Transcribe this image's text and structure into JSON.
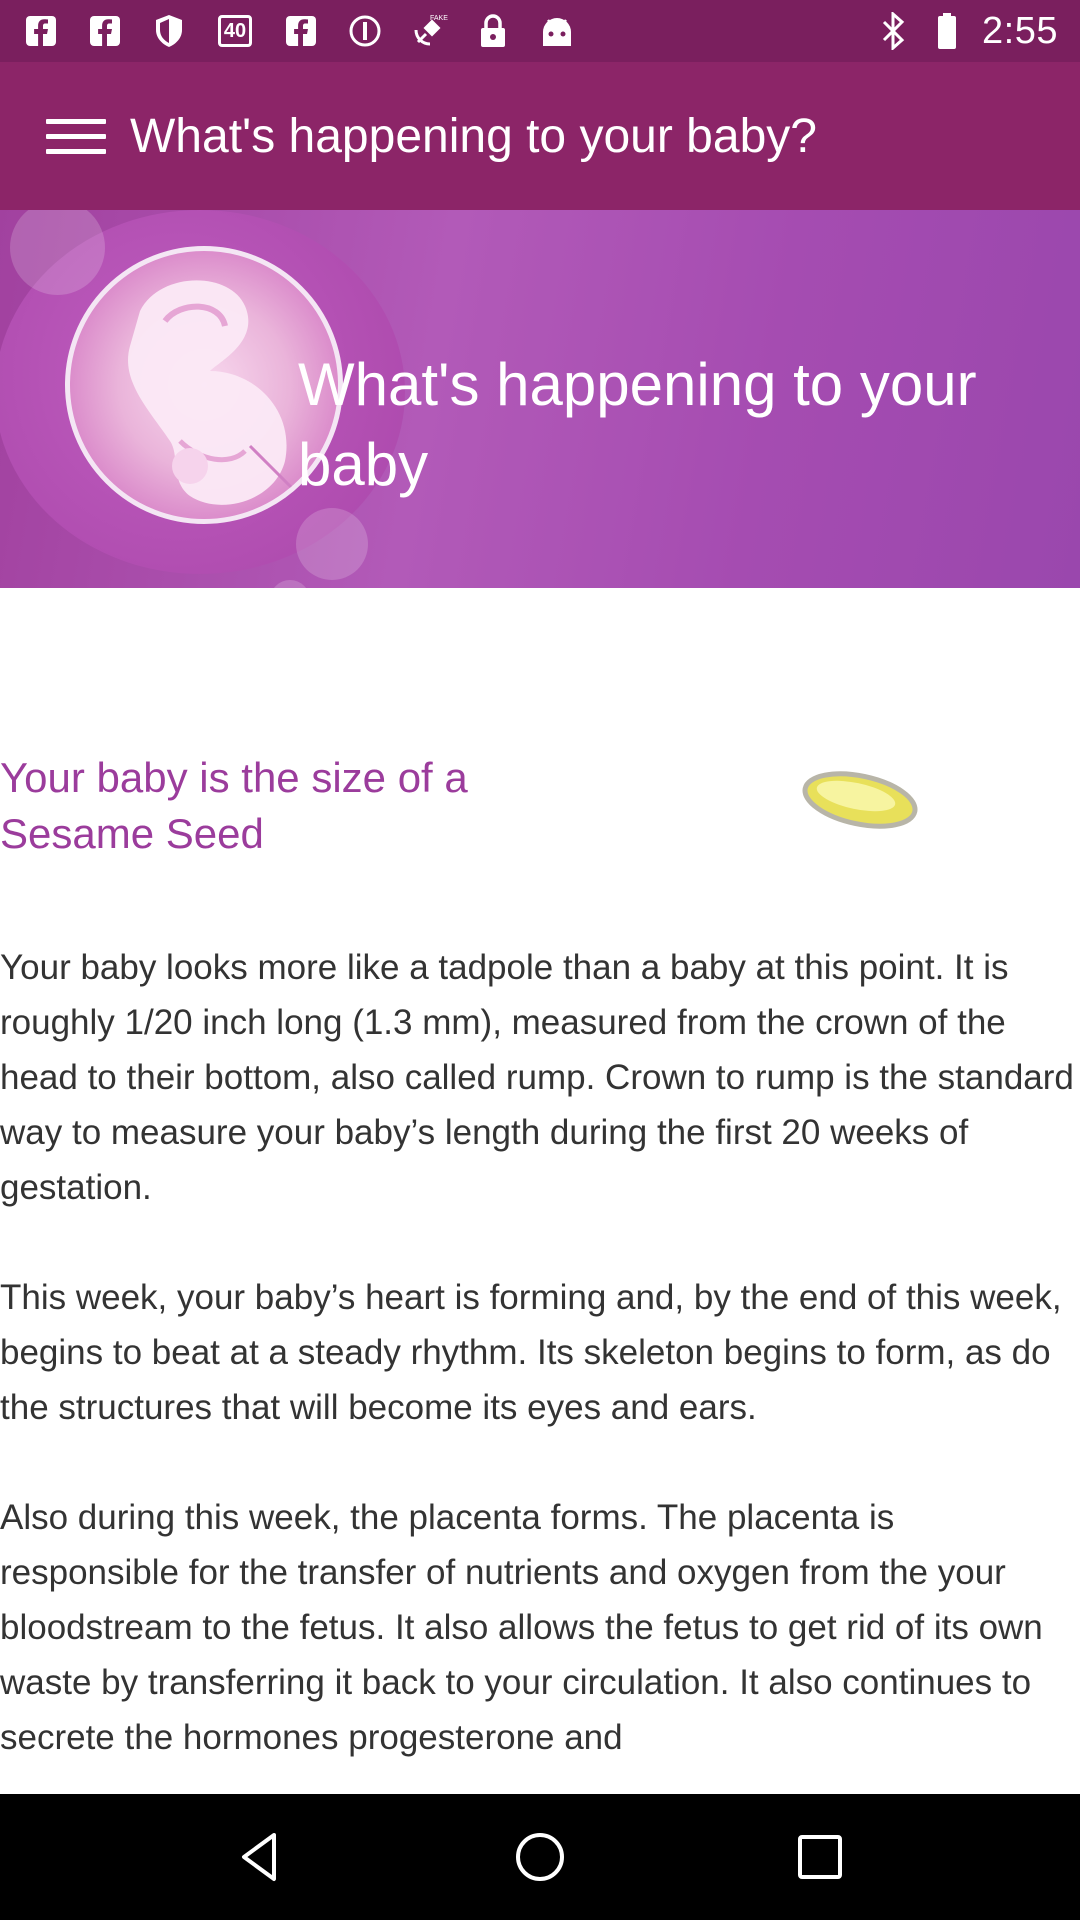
{
  "status_bar": {
    "time": "2:55",
    "left_icons": [
      "facebook-icon",
      "facebook-icon",
      "shield-icon",
      "forty-badge-icon",
      "facebook-icon",
      "info-circle-icon",
      "fake-gps-icon",
      "lock-icon",
      "android-icon"
    ],
    "badge_text": "40",
    "right_icons": [
      "bluetooth-icon"
    ]
  },
  "app_bar": {
    "title": "What's happening to your baby?"
  },
  "hero": {
    "title": "What's happening to your baby"
  },
  "size": {
    "text": "Your baby is the size of a Sesame Seed",
    "accent_color": "#9b3c9c",
    "image": "sesame-seed-icon"
  },
  "article": {
    "paragraphs": [
      "Your baby looks more like a tadpole than a baby at this point. It is roughly 1/20 inch long (1.3 mm), measured from the crown of the head to their bottom, also called rump. Crown to rump is the standard way to measure your baby’s length during the first 20 weeks of gestation.",
      "This week, your baby’s heart is forming and, by the end of this week, begins to beat at a steady rhythm. Its skeleton begins to form, as do the structures that will become its eyes and ears.",
      "Also during this week, the placenta forms. The placenta is responsible for the transfer of nutrients and oxygen from the your bloodstream to the fetus. It also allows the fetus to get rid of its own waste by transferring it back to your circulation. It also continues to secrete the hormones progesterone and"
    ]
  },
  "nav_bar": {
    "buttons": [
      "back-icon",
      "home-icon",
      "recents-icon"
    ]
  },
  "colors": {
    "status_bar": "#7a1f5e",
    "app_bar": "#8c2568",
    "hero": "#a54cb1"
  }
}
